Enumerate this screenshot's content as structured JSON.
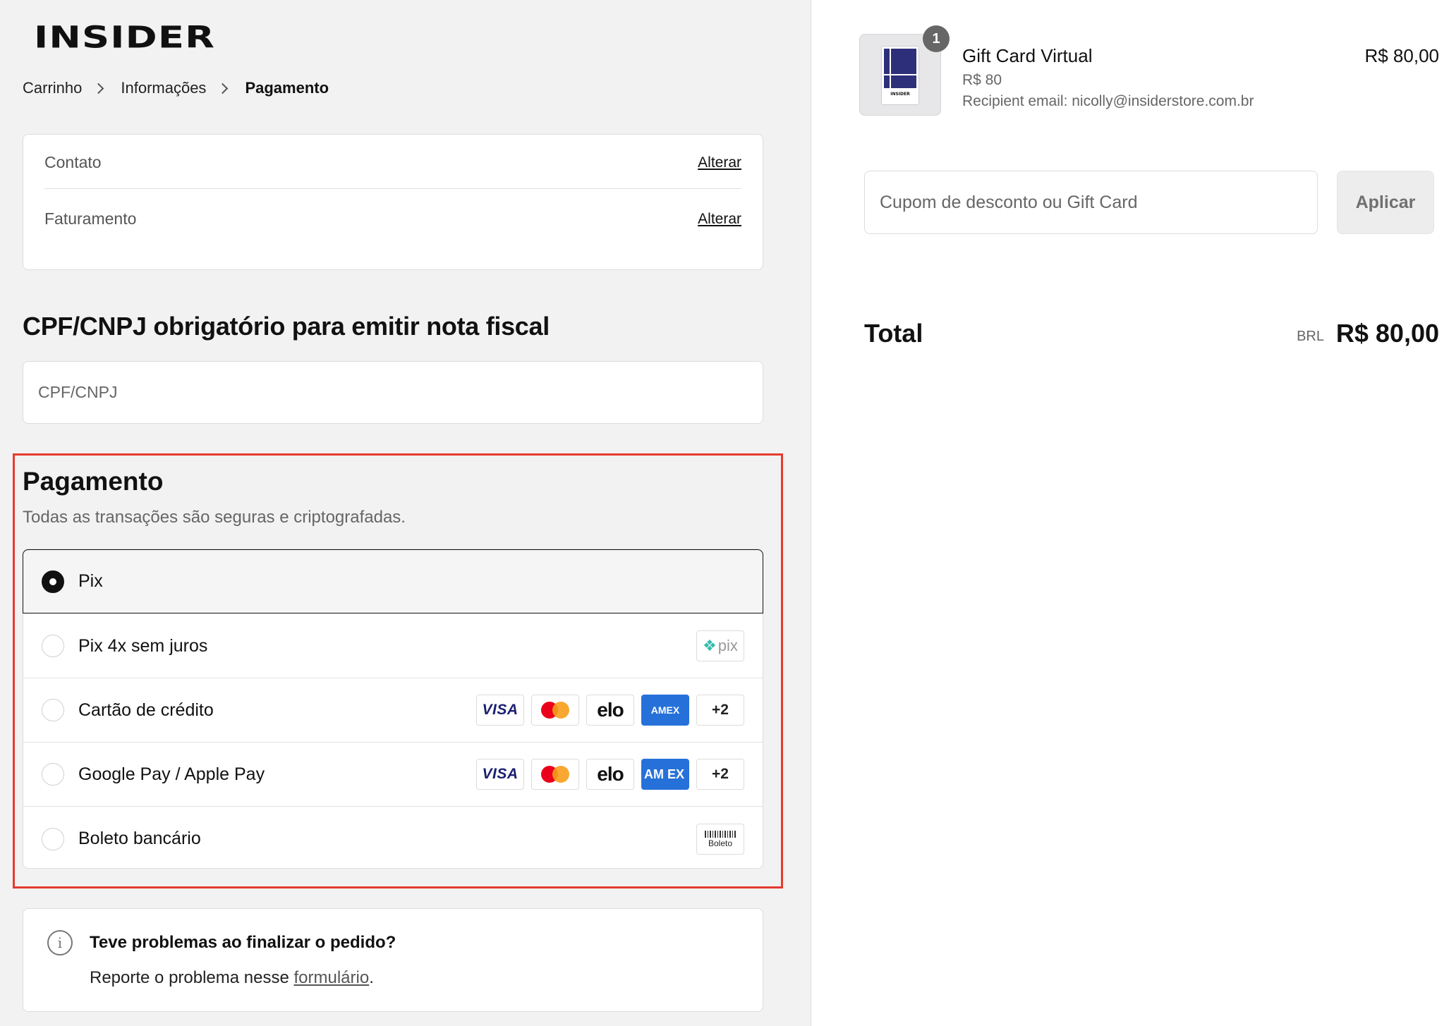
{
  "brand": {
    "logo_text": "INSIDER"
  },
  "breadcrumb": {
    "items": [
      "Carrinho",
      "Informações",
      "Pagamento"
    ]
  },
  "contact": {
    "contato_label": "Contato",
    "faturamento_label": "Faturamento",
    "change_link": "Alterar"
  },
  "cpf": {
    "title": "CPF/CNPJ obrigatório para emitir nota fiscal",
    "placeholder": "CPF/CNPJ"
  },
  "payment": {
    "title": "Pagamento",
    "subtitle": "Todas as transações são seguras e criptografadas.",
    "methods": [
      {
        "label": "Pix",
        "selected": true
      },
      {
        "label": "Pix 4x sem juros",
        "selected": false,
        "badge": "pix"
      },
      {
        "label": "Cartão de crédito",
        "selected": false,
        "badges": [
          "VISA",
          "mastercard",
          "elo",
          "AMEX",
          "+2"
        ]
      },
      {
        "label": "Google Pay / Apple Pay",
        "selected": false,
        "badges": [
          "VISA",
          "mastercard",
          "elo",
          "AMEX",
          "+2"
        ]
      },
      {
        "label": "Boleto bancário",
        "selected": false,
        "badge": "Boleto"
      }
    ],
    "badge_text": {
      "visa": "VISA",
      "elo": "elo",
      "amex": "AMEX",
      "amex_stacked": "AM EX",
      "more": "+2",
      "pix": "pix",
      "boleto": "Boleto"
    },
    "highlight_color": "#e43b2e"
  },
  "help": {
    "title": "Teve problemas ao finalizar o pedido?",
    "text_prefix": "Reporte o problema nesse ",
    "link": "formulário",
    "text_suffix": "."
  },
  "order": {
    "product_name": "Gift Card Virtual",
    "product_price": "R$ 80,00",
    "product_variant": "R$ 80",
    "product_recipient": "Recipient email: nicolly@insiderstore.com.br",
    "quantity": "1",
    "thumb_text": "INSIDER"
  },
  "coupon": {
    "placeholder": "Cupom de desconto ou Gift Card",
    "apply_label": "Aplicar"
  },
  "total": {
    "label": "Total",
    "currency": "BRL",
    "value": "R$ 80,00"
  }
}
